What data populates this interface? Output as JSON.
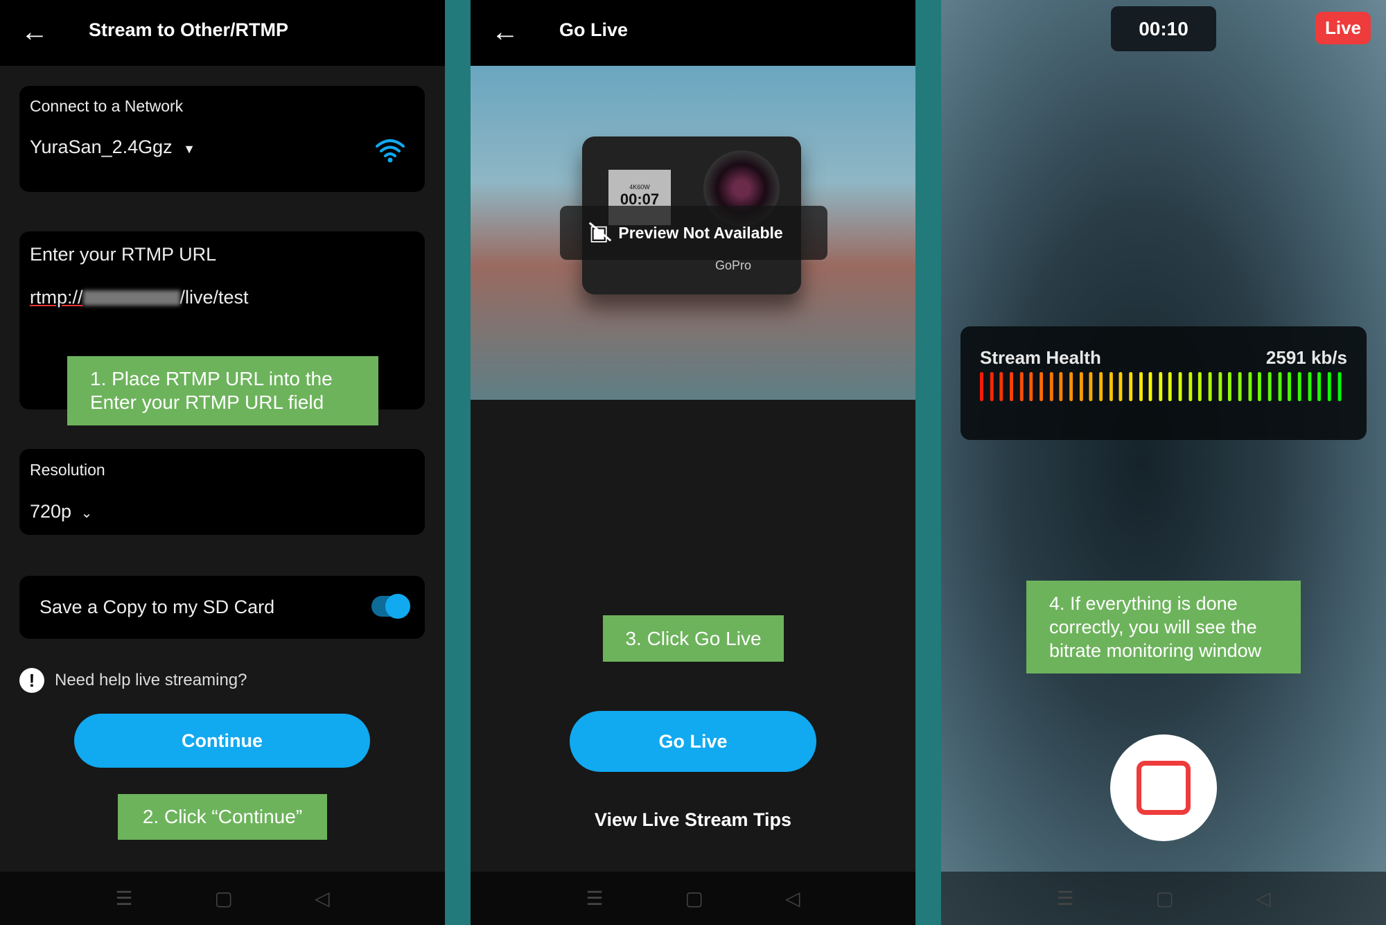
{
  "panel1": {
    "title": "Stream to Other/RTMP",
    "network_label": "Connect to a Network",
    "network_value": "YuraSan_2.4Ggz",
    "rtmp_label": "Enter your RTMP URL",
    "rtmp_prefix": "rtmp://",
    "rtmp_suffix": "/live/test",
    "resolution_label": "Resolution",
    "resolution_value": "720p",
    "sd_label": "Save a Copy to my SD Card",
    "sd_enabled": true,
    "help_text": "Need help live streaming?",
    "continue_label": "Continue",
    "note1": "1. Place RTMP URL into the Enter your RTMP URL field",
    "note2": "2. Click “Continue”"
  },
  "panel2": {
    "title": "Go Live",
    "preview_text": "Preview Not Available",
    "camera_screen": "00:07",
    "camera_mode": "4K60W",
    "camera_brand": "GoPro",
    "note3": "3. Click Go Live",
    "go_live_label": "Go Live",
    "tips_label": "View Live Stream Tips"
  },
  "panel3": {
    "timer": "00:10",
    "live_badge": "Live",
    "health_label": "Stream Health",
    "bitrate": "2591 kb/s",
    "health_bars": 37,
    "health_level": 1.0,
    "note4": "4. If everything is done correctly, you will see the bitrate monitoring window"
  },
  "nav": {
    "icons": [
      "menu-icon",
      "home-square-icon",
      "back-triangle-icon"
    ]
  },
  "colors": {
    "accent": "#11a9f0",
    "note": "#6db35c",
    "live": "#ee3b3b",
    "divider": "#237a7a"
  }
}
